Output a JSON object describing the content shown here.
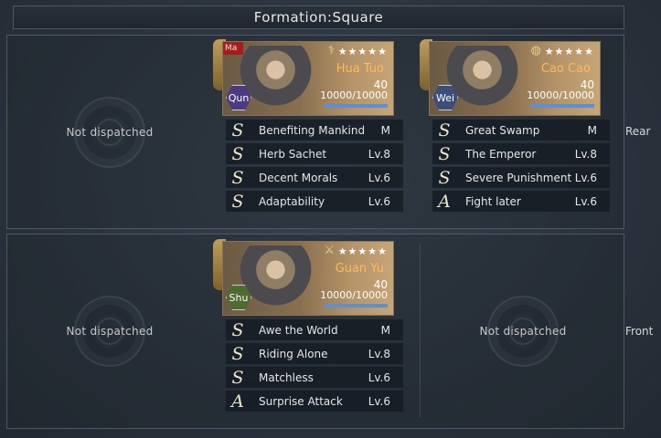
{
  "formation": {
    "title": "Formation:Square"
  },
  "rows": {
    "rear_label": "Rear",
    "front_label": "Front"
  },
  "empty_slot_text": "Not dispatched",
  "heroes": [
    {
      "name": "Hua Tuo",
      "faction": "Qun",
      "level": "40",
      "troops": "10000/10000",
      "seal": "Ma",
      "stars": "★★★★★",
      "role_icon": "caduceus-icon",
      "troop_fill": 1.0,
      "skills": [
        {
          "grade": "S",
          "name": "Benefiting Mankind",
          "level": "M"
        },
        {
          "grade": "S",
          "name": "Herb Sachet",
          "level": "Lv.8"
        },
        {
          "grade": "S",
          "name": "Decent Morals",
          "level": "Lv.6"
        },
        {
          "grade": "S",
          "name": "Adaptability",
          "level": "Lv.6"
        }
      ]
    },
    {
      "name": "Cao Cao",
      "faction": "Wei",
      "level": "40",
      "troops": "10000/10000",
      "stars": "★★★★★",
      "role_icon": "orb-icon",
      "troop_fill": 1.0,
      "skills": [
        {
          "grade": "S",
          "name": "Great Swamp",
          "level": "M"
        },
        {
          "grade": "S",
          "name": "The Emperor",
          "level": "Lv.8"
        },
        {
          "grade": "S",
          "name": "Severe Punishment",
          "level": "Lv.6"
        },
        {
          "grade": "A",
          "name": "Fight later",
          "level": "Lv.6"
        }
      ]
    },
    {
      "name": "Guan Yu",
      "faction": "Shu",
      "level": "40",
      "troops": "10000/10000",
      "stars": "★★★★★",
      "role_icon": "crossed-swords-icon",
      "troop_fill": 1.0,
      "skills": [
        {
          "grade": "S",
          "name": "Awe the World",
          "level": "M"
        },
        {
          "grade": "S",
          "name": "Riding Alone",
          "level": "Lv.8"
        },
        {
          "grade": "S",
          "name": "Matchless",
          "level": "Lv.6"
        },
        {
          "grade": "A",
          "name": "Surprise Attack",
          "level": "Lv.6"
        }
      ]
    }
  ]
}
